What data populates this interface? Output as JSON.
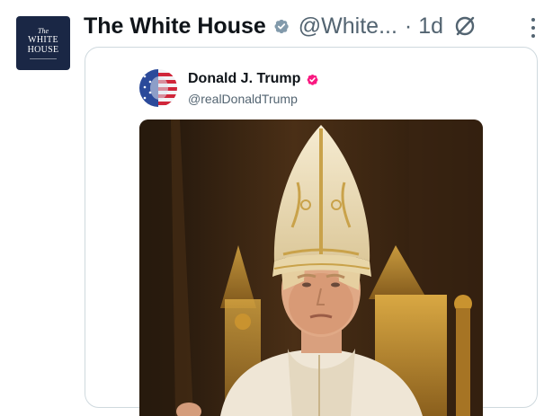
{
  "post": {
    "author": {
      "avatar_lines": [
        "The",
        "WHITE",
        "HOUSE"
      ],
      "display_name": "The White House",
      "handle": "@White...",
      "verified_badge_color": "#829aab"
    },
    "time": "· 1d",
    "icons": {
      "verified": "verified-badge-icon",
      "grok": "grok-icon",
      "more": "more-options-icon"
    }
  },
  "quoted_post": {
    "author": {
      "display_name": "Donald J. Trump",
      "handle": "@realDonaldTrump",
      "verified_badge_color": "#f91880"
    },
    "image": "ai-generated-image-of-donald-trump-dressed-as-pope"
  },
  "colors": {
    "text_primary": "#0f1419",
    "text_secondary": "#536471",
    "border": "#cfd9de",
    "avatar_bg": "#1a2745"
  }
}
